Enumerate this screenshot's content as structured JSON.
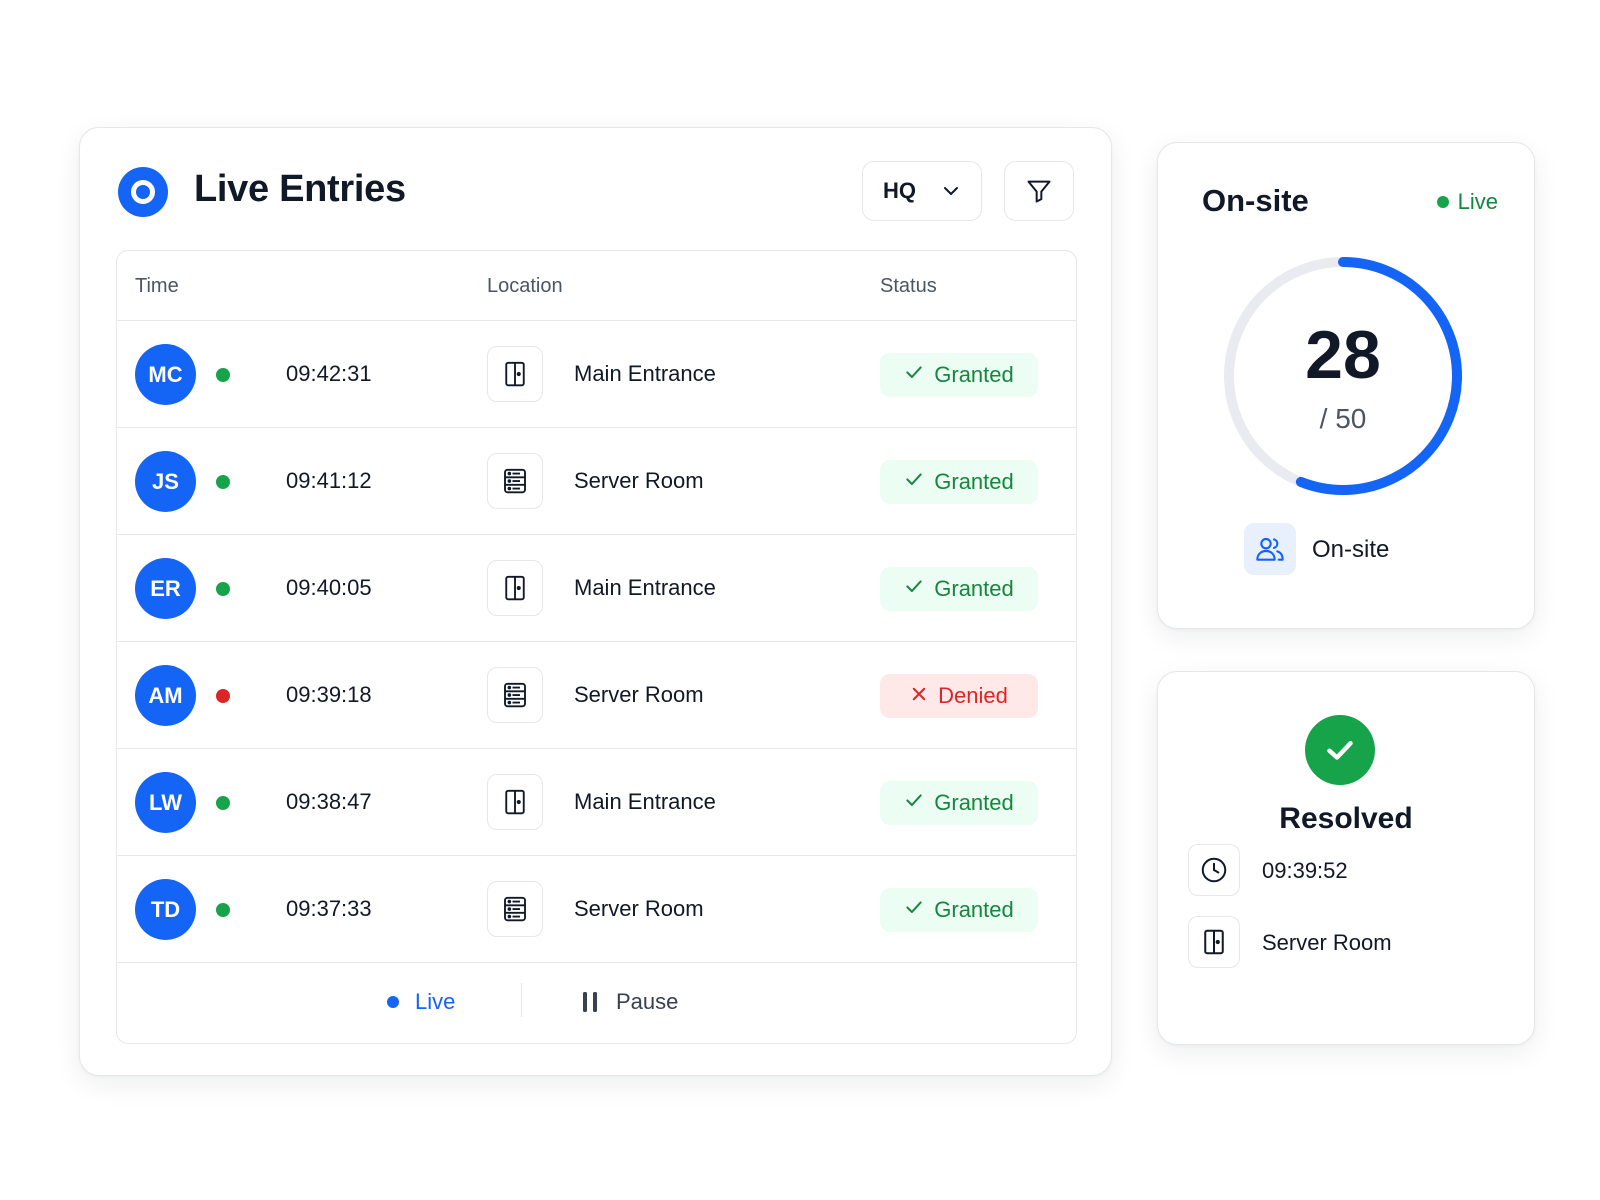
{
  "colors": {
    "accent": "#1464f6",
    "success": "#16a34a",
    "danger": "#dc2626",
    "gauge_track": "#e9ebf0"
  },
  "entries": {
    "title": "Live Entries",
    "site_selector": {
      "value": "HQ"
    },
    "columns": {
      "time": "Time",
      "location": "Location",
      "status": "Status"
    },
    "rows": [
      {
        "initials": "MC",
        "presence": "green",
        "time": "09:42:31",
        "location": "Main Entrance",
        "location_icon": "door-icon",
        "status": "Granted",
        "status_type": "granted"
      },
      {
        "initials": "JS",
        "presence": "green",
        "time": "09:41:12",
        "location": "Server Room",
        "location_icon": "server-icon",
        "status": "Granted",
        "status_type": "granted"
      },
      {
        "initials": "ER",
        "presence": "green",
        "time": "09:40:05",
        "location": "Main Entrance",
        "location_icon": "door-icon",
        "status": "Granted",
        "status_type": "granted"
      },
      {
        "initials": "AM",
        "presence": "red",
        "time": "09:39:18",
        "location": "Server Room",
        "location_icon": "server-icon",
        "status": "Denied",
        "status_type": "denied"
      },
      {
        "initials": "LW",
        "presence": "green",
        "time": "09:38:47",
        "location": "Main Entrance",
        "location_icon": "door-icon",
        "status": "Granted",
        "status_type": "granted"
      },
      {
        "initials": "TD",
        "presence": "green",
        "time": "09:37:33",
        "location": "Server Room",
        "location_icon": "server-icon",
        "status": "Granted",
        "status_type": "granted"
      }
    ],
    "footer": {
      "live_label": "Live",
      "pause_label": "Pause"
    }
  },
  "onsite": {
    "title": "On-site",
    "live_label": "Live",
    "count": 28,
    "capacity": 50,
    "total_label": "/ 50",
    "label": "On-site",
    "icon": "users-icon"
  },
  "resolved": {
    "title": "Resolved",
    "time": "09:39:52",
    "location": "Server Room",
    "icons": {
      "time": "clock-icon",
      "location": "door-icon"
    }
  }
}
